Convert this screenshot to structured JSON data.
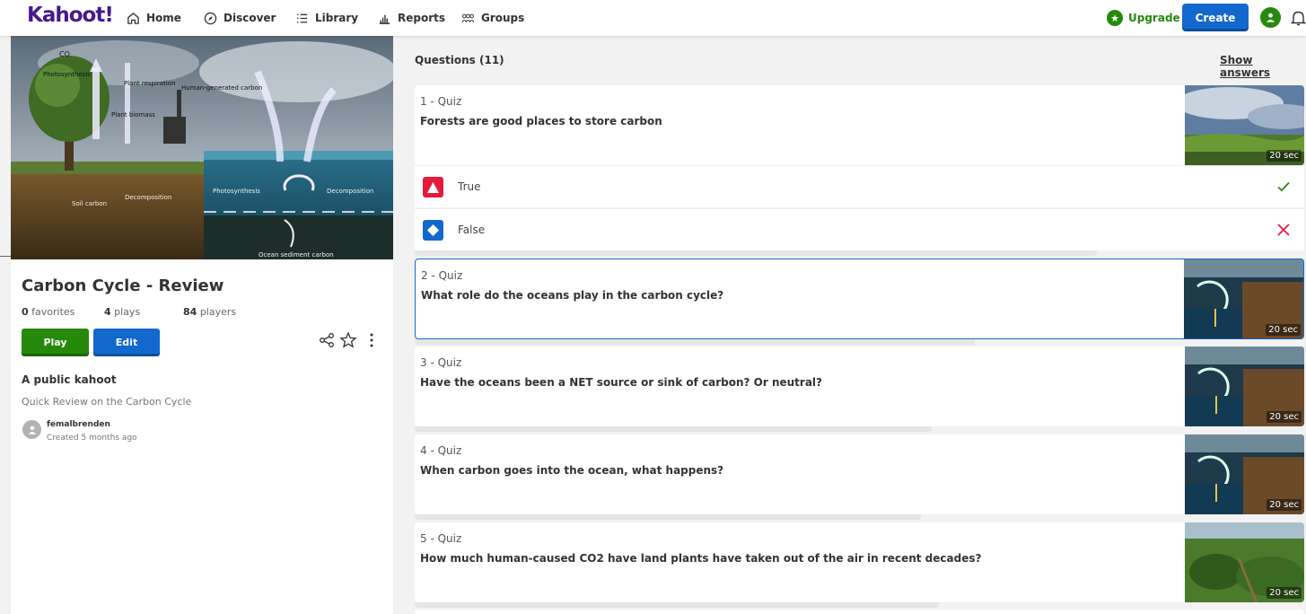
{
  "nav": {
    "logo": "Kahoot!",
    "items": [
      {
        "label": "Home",
        "icon": "home-icon"
      },
      {
        "label": "Discover",
        "icon": "compass-icon"
      },
      {
        "label": "Library",
        "icon": "list-icon"
      },
      {
        "label": "Reports",
        "icon": "bar-chart-icon"
      },
      {
        "label": "Groups",
        "icon": "groups-icon"
      }
    ],
    "upgrade_label": "Upgrade",
    "create_label": "Create"
  },
  "kahoot": {
    "title": "Carbon Cycle - Review",
    "favorites_count": "0",
    "favorites_label": "favorites",
    "plays_count": "4",
    "plays_label": "plays",
    "players_count": "84",
    "players_label": "players",
    "play_label": "Play",
    "edit_label": "Edit",
    "visibility": "A public kahoot",
    "description": "Quick Review on the Carbon Cycle",
    "creator": "femalbrenden",
    "created": "Created 5 months ago"
  },
  "cover_labels": {
    "co2": "CO",
    "photosynthesis": "Photosynthesis",
    "plant_respiration": "Plant respiration",
    "human_generated": "Human-generated carbon",
    "plant_biomass": "Plant biomass",
    "decomposition": "Decomposition",
    "soil_carbon": "Soil carbon",
    "ocean_photosynthesis": "Photosynthesis",
    "ocean_decomposition": "Decomposition",
    "ocean_sediment": "Ocean sediment carbon"
  },
  "questions_header": "Questions (11)",
  "show_answers_label": "Show answers",
  "questions": [
    {
      "type": "1 - Quiz",
      "text": "Forests are good places to store carbon",
      "time": "20 sec"
    },
    {
      "type": "2 - Quiz",
      "text": "What role do the oceans play in the carbon cycle?",
      "time": "20 sec"
    },
    {
      "type": "3 - Quiz",
      "text": "Have the oceans been a NET source or sink of carbon? Or neutral?",
      "time": "20 sec"
    },
    {
      "type": "4 - Quiz",
      "text": "When carbon goes into the ocean, what happens?",
      "time": "20 sec"
    },
    {
      "type": "5 - Quiz",
      "text": "How much human-caused CO2 have land plants have taken out of the air in recent decades?",
      "time": "20 sec"
    }
  ],
  "answers": [
    {
      "text": "True",
      "shape": "triangle-icon",
      "color": "#e21b3c",
      "correct": true
    },
    {
      "text": "False",
      "shape": "diamond-icon",
      "color": "#1368ce",
      "correct": false
    }
  ],
  "colors": {
    "brand": "#46178f",
    "green": "#26890c",
    "blue": "#1368ce",
    "red": "#e21b3c"
  }
}
